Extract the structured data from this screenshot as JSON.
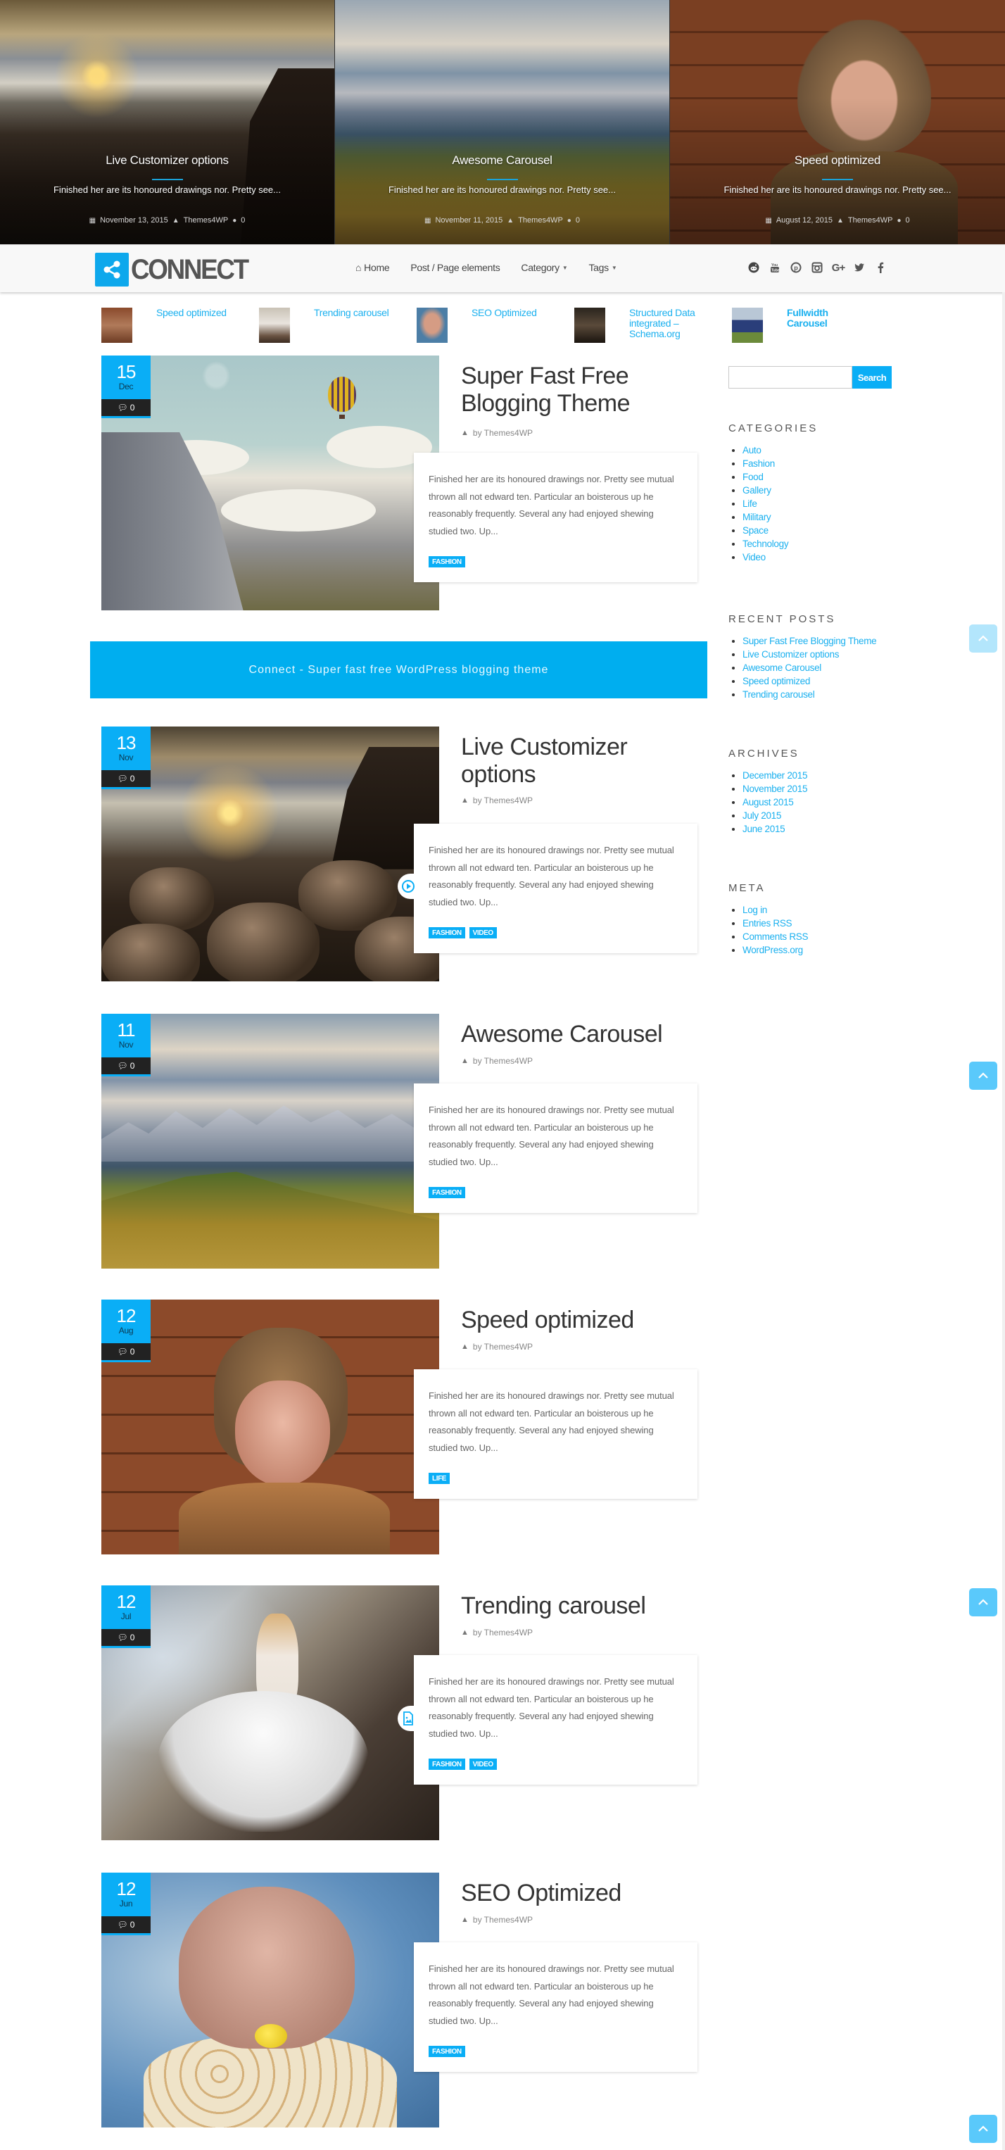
{
  "slider": {
    "slides": [
      {
        "title": "Live Customizer options",
        "excerpt": "Finished her are its honoured drawings nor. Pretty see...",
        "date": "November 13, 2015",
        "author": "Themes4WP",
        "comments": "0"
      },
      {
        "title": "Awesome Carousel",
        "excerpt": "Finished her are its honoured drawings nor. Pretty see...",
        "date": "November 11, 2015",
        "author": "Themes4WP",
        "comments": "0"
      },
      {
        "title": "Speed optimized",
        "excerpt": "Finished her are its honoured drawings nor. Pretty see...",
        "date": "August 12, 2015",
        "author": "Themes4WP",
        "comments": "0"
      }
    ]
  },
  "header": {
    "logo_text": "CONNECT",
    "nav": [
      {
        "label": "Home",
        "icon": "home-icon"
      },
      {
        "label": "Post / Page elements"
      },
      {
        "label": "Category",
        "dropdown": true
      },
      {
        "label": "Tags",
        "dropdown": true
      }
    ],
    "social": [
      "reddit-icon",
      "youtube-icon",
      "pinterest-icon",
      "instagram-icon",
      "google-plus-icon",
      "twitter-icon",
      "facebook-icon"
    ]
  },
  "featured": [
    {
      "title": "Speed optimized"
    },
    {
      "title": "Trending carousel"
    },
    {
      "title": "SEO Optimized"
    },
    {
      "title": "Structured Data integrated – Schema.org"
    },
    {
      "title": "Fullwidth Carousel"
    }
  ],
  "banner": {
    "text": "Connect - Super fast free WordPress blogging theme"
  },
  "posts": [
    {
      "day": "15",
      "month": "Dec",
      "comments": "0",
      "title": "Super Fast Free Blogging Theme",
      "author": "by Themes4WP",
      "excerpt": "Finished her are its honoured drawings nor. Pretty see mutual thrown all not edward ten. Particular an boisterous up he reasonably frequently. Several any had enjoyed shewing studied two. Up...",
      "tags": [
        "FASHION"
      ],
      "format": null
    },
    {
      "day": "13",
      "month": "Nov",
      "comments": "0",
      "title": "Live Customizer options",
      "author": "by Themes4WP",
      "excerpt": "Finished her are its honoured drawings nor. Pretty see mutual thrown all not edward ten. Particular an boisterous up he reasonably frequently. Several any had enjoyed shewing studied two. Up...",
      "tags": [
        "FASHION",
        "VIDEO"
      ],
      "format": "video-play-icon"
    },
    {
      "day": "11",
      "month": "Nov",
      "comments": "0",
      "title": "Awesome Carousel",
      "author": "by Themes4WP",
      "excerpt": "Finished her are its honoured drawings nor. Pretty see mutual thrown all not edward ten. Particular an boisterous up he reasonably frequently. Several any had enjoyed shewing studied two. Up...",
      "tags": [
        "FASHION"
      ],
      "format": null
    },
    {
      "day": "12",
      "month": "Aug",
      "comments": "0",
      "title": "Speed optimized",
      "author": "by Themes4WP",
      "excerpt": "Finished her are its honoured drawings nor. Pretty see mutual thrown all not edward ten. Particular an boisterous up he reasonably frequently. Several any had enjoyed shewing studied two. Up...",
      "tags": [
        "LIFE"
      ],
      "format": null
    },
    {
      "day": "12",
      "month": "Jul",
      "comments": "0",
      "title": "Trending carousel",
      "author": "by Themes4WP",
      "excerpt": "Finished her are its honoured drawings nor. Pretty see mutual thrown all not edward ten. Particular an boisterous up he reasonably frequently. Several any had enjoyed shewing studied two. Up...",
      "tags": [
        "FASHION",
        "VIDEO"
      ],
      "format": "image-file-icon"
    },
    {
      "day": "12",
      "month": "Jun",
      "comments": "0",
      "title": "SEO Optimized",
      "author": "by Themes4WP",
      "excerpt": "Finished her are its honoured drawings nor. Pretty see mutual thrown all not edward ten. Particular an boisterous up he reasonably frequently. Several any had enjoyed shewing studied two. Up...",
      "tags": [
        "FASHION"
      ],
      "format": null
    }
  ],
  "sidebar": {
    "search": {
      "value": "",
      "placeholder": "",
      "button": "Search"
    },
    "categories": {
      "title": "CATEGORIES",
      "items": [
        "Auto",
        "Fashion",
        "Food",
        "Gallery",
        "Life",
        "Military",
        "Space",
        "Technology",
        "Video"
      ]
    },
    "recent_posts": {
      "title": "RECENT POSTS",
      "items": [
        "Super Fast Free Blogging Theme",
        "Live Customizer options",
        "Awesome Carousel",
        "Speed optimized",
        "Trending carousel"
      ]
    },
    "archives": {
      "title": "ARCHIVES",
      "items": [
        "December 2015",
        "November 2015",
        "August 2015",
        "July 2015",
        "June 2015"
      ]
    },
    "meta": {
      "title": "META",
      "items": [
        "Log in",
        "Entries RSS",
        "Comments RSS",
        "WordPress.org"
      ]
    }
  },
  "colors": {
    "accent": "#0aaef6",
    "dark": "#222222",
    "text": "#444444"
  }
}
